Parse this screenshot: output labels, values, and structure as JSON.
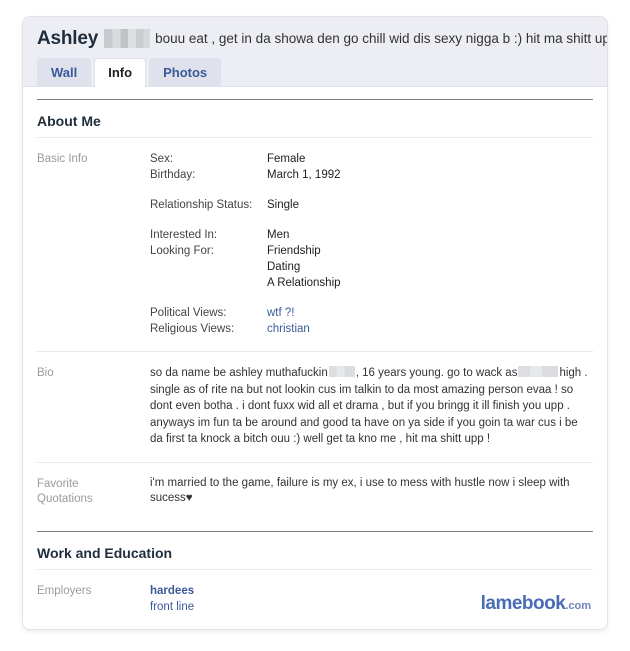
{
  "profile": {
    "name": "Ashley",
    "name_redacted": true,
    "status_text": "bouu eat , get in da showa den go chill wid dis sexy nigga b :) hit ma shitt uppp !",
    "tabs": [
      {
        "label": "Wall",
        "active": false
      },
      {
        "label": "Info",
        "active": true
      },
      {
        "label": "Photos",
        "active": false
      }
    ]
  },
  "sections": {
    "about_me": {
      "heading": "About Me",
      "basic_info": {
        "label": "Basic Info",
        "fields": [
          {
            "key": "Sex:",
            "value": "Female",
            "link": false
          },
          {
            "key": "Birthday:",
            "value": "March 1, 1992",
            "link": false
          },
          {
            "key": "Relationship Status:",
            "value": "Single",
            "link": false
          },
          {
            "key": "Interested In:",
            "value": "Men",
            "link": false
          },
          {
            "key": "Looking For:",
            "value": "Friendship",
            "link": false
          },
          {
            "key": "",
            "value": "Dating",
            "link": false
          },
          {
            "key": "",
            "value": "A Relationship",
            "link": false
          },
          {
            "key": "Political Views:",
            "value": "wtf ?!",
            "link": true
          },
          {
            "key": "Religious Views:",
            "value": "christian",
            "link": true
          }
        ]
      },
      "bio": {
        "label": "Bio",
        "text_part_1": "so da name be ashley muthafuckin",
        "text_part_2": ", 16 years young. go to wack as",
        "text_part_3": "high . single as of rite na but not lookin cus im talkin to da most amazing person evaa ! so dont even botha . i dont fuxx wid all et drama , but if you bringg it ill finish you upp . anyways im fun ta be around and good ta have on ya side if you goin ta war cus i be da first ta knock a bitch ouu :) well get ta kno me , hit ma shitt upp !"
      },
      "favorite_quotations": {
        "label_line_1": "Favorite",
        "label_line_2": "Quotations",
        "text": "i'm married to the game, failure is my ex, i use to mess with hustle now i sleep with sucess♥"
      }
    },
    "work_and_education": {
      "heading": "Work and Education",
      "employers": {
        "label": "Employers",
        "name": "hardees",
        "role": "front line"
      }
    }
  },
  "watermark": {
    "brand": "lamebook",
    "tld": ".com"
  },
  "colors": {
    "header_bg": "#eceef4",
    "tab_link": "#3b5998",
    "label_gray": "#9a9a9a",
    "watermark_blue": "#4a6bb5"
  }
}
